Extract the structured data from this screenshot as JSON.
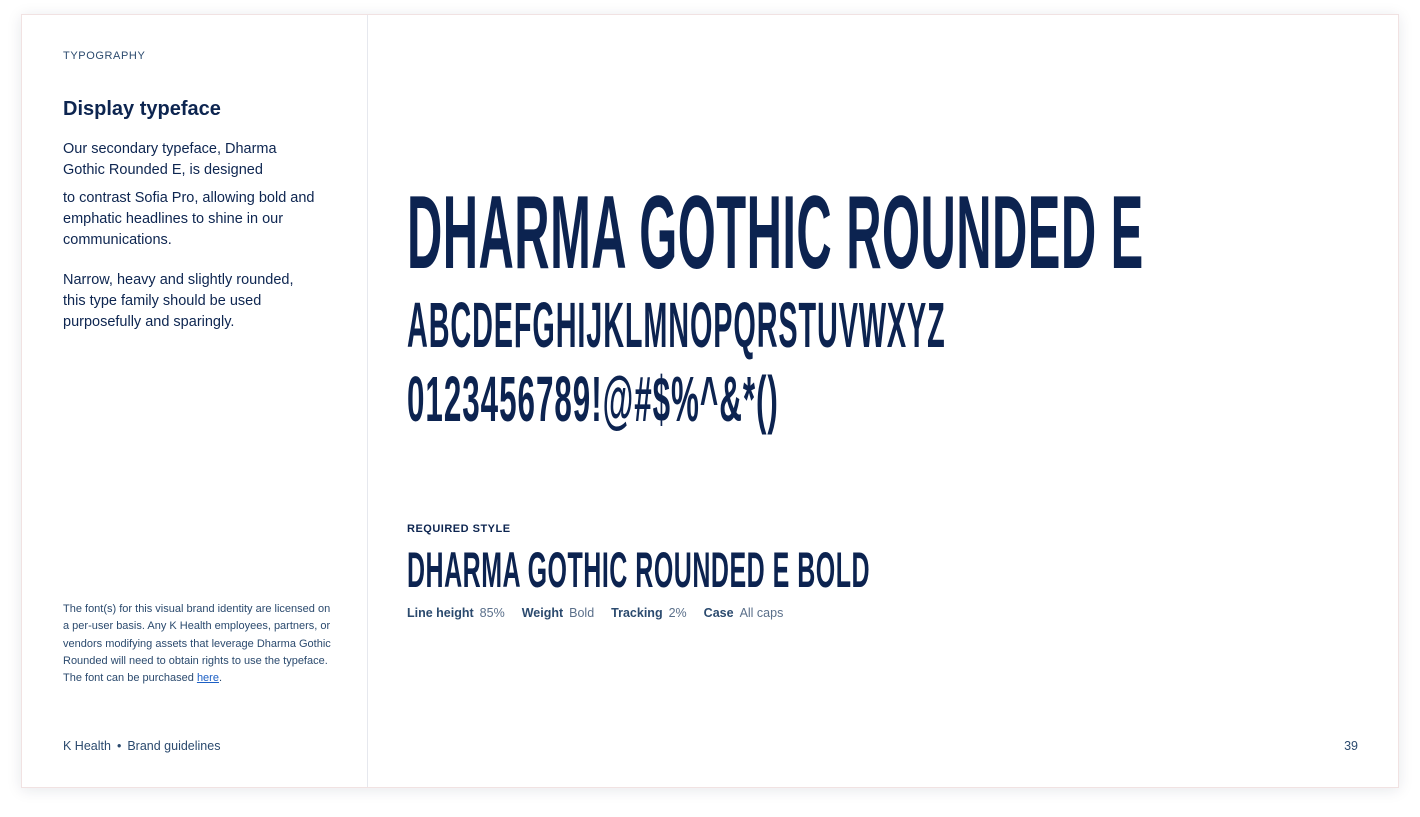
{
  "sidebar": {
    "section_label": "TYPOGRAPHY",
    "heading": "Display typeface",
    "paragraph_1": "Our secondary typeface, Dharma Gothic Rounded E, is designed",
    "paragraph_2": "to contrast Sofia Pro, allowing bold and emphatic headlines to shine in our communications.",
    "paragraph_3": "Narrow, heavy and slightly rounded, this type family should be used purposefully and sparingly.",
    "license_text": "The font(s) for this visual brand identity are licensed on a per-user basis. Any K Health employees, partners, or vendors modifying assets that leverage Dharma Gothic Rounded will need to obtain rights to use the typeface. The font can be purchased ",
    "license_link": "here",
    "license_end": "."
  },
  "footer": {
    "brand": "K Health",
    "separator": "•",
    "doc_title": "Brand guidelines",
    "page_number": "39"
  },
  "specimen": {
    "font_name": "DHARMA GOTHIC ROUNDED E",
    "alphabet": "ABCDEFGHIJKLMNOPQRSTUVWXYZ",
    "numerals_symbols": "0123456789!@#$%^&*()"
  },
  "required_style": {
    "label": "REQUIRED STYLE",
    "style_name": "DHARMA GOTHIC ROUNDED E BOLD",
    "specs": [
      {
        "label": "Line height",
        "value": "85%"
      },
      {
        "label": "Weight",
        "value": "Bold"
      },
      {
        "label": "Tracking",
        "value": "2%"
      },
      {
        "label": "Case",
        "value": "All caps"
      }
    ]
  }
}
